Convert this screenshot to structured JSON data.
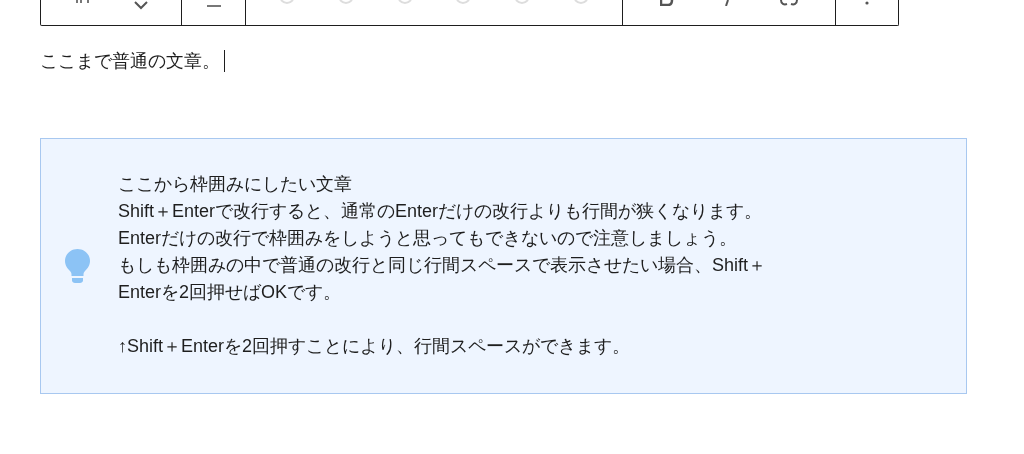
{
  "paragraph": {
    "text": "ここまで普通の文章。",
    "caret": true
  },
  "callout": {
    "paragraphs": [
      [
        "ここから枠囲みにしたい文章",
        "Shift＋Enterで改行すると、通常のEnterだけの改行よりも行間が狭くなります。",
        "Enterだけの改行で枠囲みをしようと思ってもできないので注意しましょう。",
        "もしも枠囲みの中で普通の改行と同じ行間スペースで表示させたい場合、Shift＋",
        "Enterを2回押せばOKです。"
      ],
      [
        "↑Shift＋Enterを2回押すことにより、行間スペースができます。"
      ]
    ]
  }
}
